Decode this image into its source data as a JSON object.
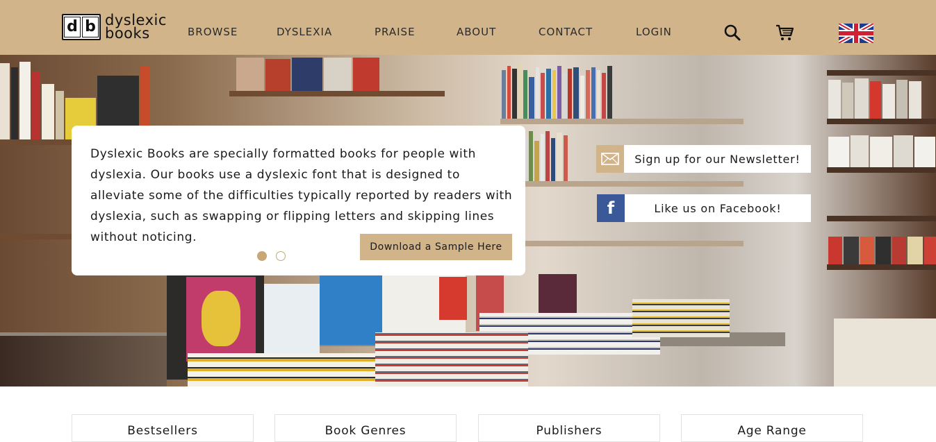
{
  "brand": {
    "logo_letters": "db",
    "name_line1": "dyslexic",
    "name_line2": "books",
    "accent": "#d1b48a"
  },
  "nav": {
    "items": [
      {
        "label": "BROWSE"
      },
      {
        "label": "DYSLEXIA"
      },
      {
        "label": "PRAISE"
      },
      {
        "label": "ABOUT"
      },
      {
        "label": "CONTACT"
      },
      {
        "label": "LOGIN"
      }
    ],
    "icons": [
      "search-icon",
      "cart-icon",
      "uk-flag-icon"
    ]
  },
  "hero": {
    "description": "Dyslexic Books are specially formatted books for people with dyslexia. Our books use a dyslexic font that is designed to alleviate some of the difficulties typically reported by readers with dyslexia, such as swapping or flipping letters and skipping lines without noticing.",
    "sample_button": "Download a Sample Here",
    "slides": {
      "total": 2,
      "active": 1
    }
  },
  "social": {
    "newsletter": "Sign up for our Newsletter!",
    "facebook": "Like us on Facebook!",
    "facebook_color": "#3b5998"
  },
  "categories": [
    {
      "label": "Bestsellers"
    },
    {
      "label": "Book Genres"
    },
    {
      "label": "Publishers"
    },
    {
      "label": "Age Range"
    }
  ]
}
